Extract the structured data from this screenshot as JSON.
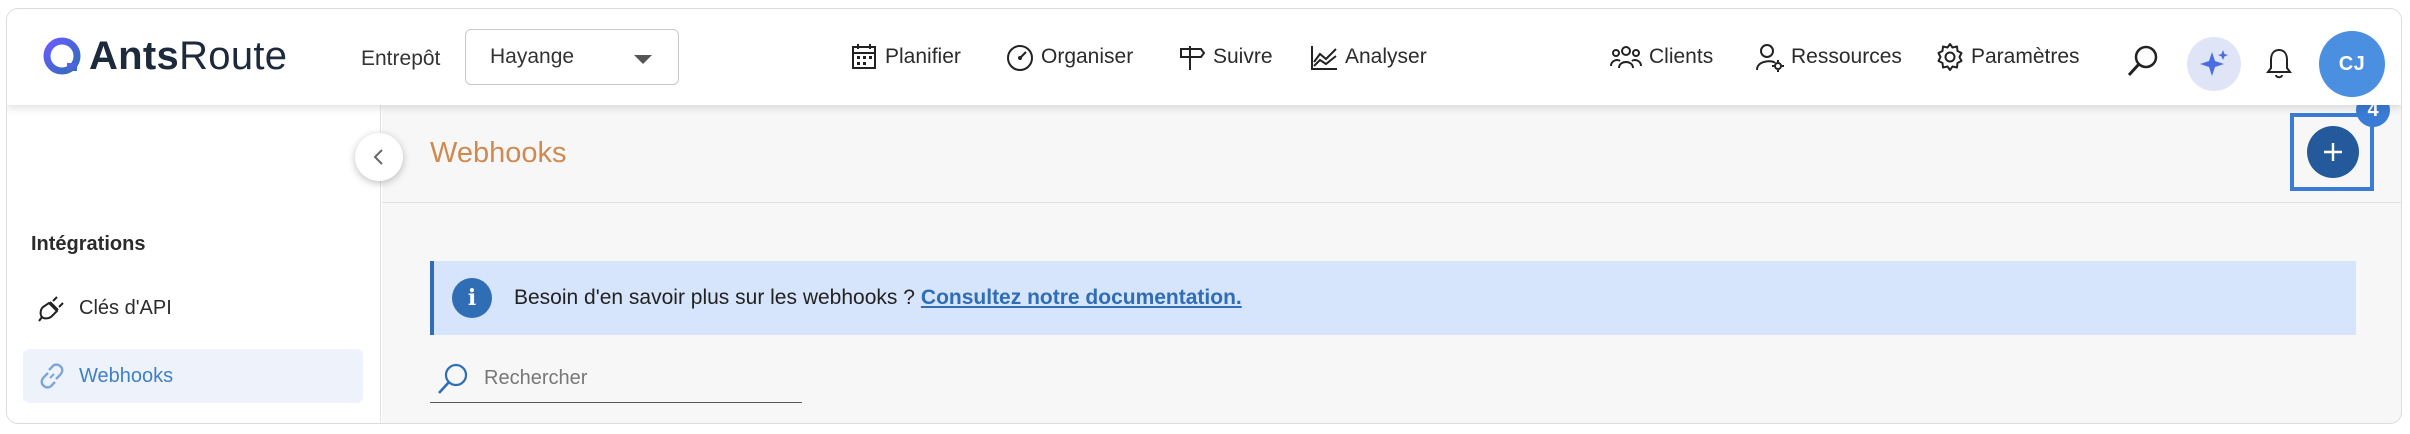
{
  "brand": {
    "name_bold": "Ants",
    "name_light": "Route"
  },
  "header": {
    "warehouse_label": "Entrepôt",
    "warehouse_value": "Hayange",
    "nav": [
      {
        "label": "Planifier",
        "icon": "calendar-icon"
      },
      {
        "label": "Organiser",
        "icon": "gauge-icon"
      },
      {
        "label": "Suivre",
        "icon": "signpost-icon"
      },
      {
        "label": "Analyser",
        "icon": "chart-icon"
      }
    ],
    "right_nav": [
      {
        "label": "Clients",
        "icon": "clients-icon"
      },
      {
        "label": "Ressources",
        "icon": "resources-icon"
      },
      {
        "label": "Paramètres",
        "icon": "gear-icon"
      }
    ],
    "avatar_initials": "CJ"
  },
  "sidebar": {
    "section_title": "Intégrations",
    "items": [
      {
        "label": "Clés d'API",
        "icon": "plug-icon",
        "active": false
      },
      {
        "label": "Webhooks",
        "icon": "link-icon",
        "active": true
      }
    ]
  },
  "main": {
    "title": "Webhooks",
    "add_badge": "4",
    "info_text": "Besoin d'en savoir plus sur les webhooks ?",
    "info_link": "Consultez notre documentation.",
    "search_placeholder": "Rechercher"
  },
  "colors": {
    "accent": "#2f6db5",
    "title": "#cf8a52",
    "info_bg": "#d6e5fb",
    "avatar": "#4a8fe0",
    "highlight": "#3a7bd5"
  }
}
